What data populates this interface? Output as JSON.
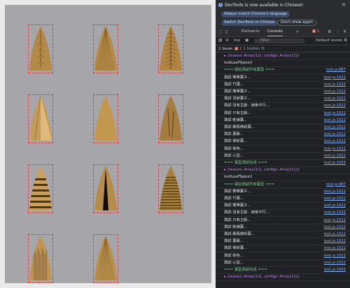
{
  "leaves": [
    {
      "id": "leaf-r1c1",
      "type": "veined",
      "color": "#b48a4a"
    },
    {
      "id": "leaf-r1c2",
      "type": "striped",
      "color": "#b58a48"
    },
    {
      "id": "leaf-r1c3",
      "type": "feathered",
      "color": "#b08444"
    },
    {
      "id": "leaf-r2c1",
      "type": "faceted",
      "color": "#c49c58"
    },
    {
      "id": "leaf-r2c2",
      "type": "plain",
      "color": "#c29850"
    },
    {
      "id": "leaf-r2c3",
      "type": "weathered",
      "color": "#a47c40"
    },
    {
      "id": "leaf-r3c1",
      "type": "banded",
      "color": "#c8a060"
    },
    {
      "id": "leaf-r3c2",
      "type": "dark-center",
      "color": "#b68c4c"
    },
    {
      "id": "leaf-r3c3",
      "type": "ribbed",
      "color": "#a8803e"
    },
    {
      "id": "leaf-r4c1",
      "type": "textured",
      "color": "#bf9454"
    },
    {
      "id": "leaf-r4c2",
      "type": "fine-striped",
      "color": "#b8904e"
    }
  ],
  "devtools": {
    "notice": {
      "message": "DevTools is now available in Chinese!",
      "match_button": "Always match Chrome's language",
      "switch_button": "Switch DevTools to Chinese",
      "dismiss_button": "Don't show again",
      "close_icon": "close-icon"
    },
    "tabs": {
      "elements": "Elements",
      "console": "Console",
      "error_count": "1"
    },
    "toolbar": {
      "context": "top",
      "filter_placeholder": "Filter",
      "levels": "Default levels"
    },
    "issues": {
      "label": "1 Issue:",
      "error_count": "1",
      "hidden": "1 hidden"
    },
    "console_rows": [
      {
        "text": "▸ {leaves: Array(11), configs: Array(11)}",
        "link": "",
        "cls": "hdr"
      },
      {
        "text": "testLeafTypes()",
        "link": "",
        "cls": "fn"
      },
      {
        "text": "=== 開始測試所有葉型 ===",
        "link": "test.js:987",
        "cls": "sys"
      },
      {
        "text": "測試 簡單葉子...",
        "link": "test.js:1022",
        "cls": ""
      },
      {
        "text": "測試 竹葉...",
        "link": "test.js:1022",
        "cls": ""
      },
      {
        "text": "測試 簡單葉子...",
        "link": "test.js:1022",
        "cls": ""
      },
      {
        "text": "測試 羽狀葉子...",
        "link": "test.js:1022",
        "cls": ""
      },
      {
        "text": "測試 沒有主脈 - 雨後平行...",
        "link": "test.js:1022",
        "cls": ""
      },
      {
        "text": "測試 只有主脈...",
        "link": "test.js:1022",
        "cls": ""
      },
      {
        "text": "測試 乾燥葉...",
        "link": "test.js:1022",
        "cls": ""
      },
      {
        "text": "測試 細長條紋葉...",
        "link": "test.js:1022",
        "cls": ""
      },
      {
        "text": "測試 葉脈...",
        "link": "test.js:1022",
        "cls": ""
      },
      {
        "text": "測試 條紋葉...",
        "link": "test.js:1022",
        "cls": ""
      },
      {
        "text": "測試 棕色...",
        "link": "test.js:1022",
        "cls": ""
      },
      {
        "text": "測試 心型...",
        "link": "test.js:1022",
        "cls": ""
      },
      {
        "text": "=== 葉型測試完成 ===",
        "link": "test.js:1055",
        "cls": "sys"
      },
      {
        "text": "▸ {leaves: Array(11), configs: Array(11)}",
        "link": "",
        "cls": "hdr"
      },
      {
        "text": "testLeafTypes()",
        "link": "",
        "cls": "fn"
      },
      {
        "text": "=== 開始測試所有葉型 ===",
        "link": "test.js:987",
        "cls": "sys"
      },
      {
        "text": "測試 簡單葉子...",
        "link": "test.js:1022",
        "cls": ""
      },
      {
        "text": "測試 竹葉...",
        "link": "test.js:1022",
        "cls": ""
      },
      {
        "text": "測試 簡單葉子...",
        "link": "test.js:1022",
        "cls": ""
      },
      {
        "text": "測試 沒有主脈 - 雨後平行...",
        "link": "test.js:1022",
        "cls": ""
      },
      {
        "text": "測試 只有主脈...",
        "link": "test.js:1022",
        "cls": ""
      },
      {
        "text": "測試 乾燥葉...",
        "link": "test.js:1022",
        "cls": ""
      },
      {
        "text": "測試 細長條紋葉...",
        "link": "test.js:1022",
        "cls": ""
      },
      {
        "text": "測試 葉脈...",
        "link": "test.js:1022",
        "cls": ""
      },
      {
        "text": "測試 條紋葉...",
        "link": "test.js:1022",
        "cls": ""
      },
      {
        "text": "測試 棕色...",
        "link": "test.js:1022",
        "cls": ""
      },
      {
        "text": "測試 心型...",
        "link": "test.js:1022",
        "cls": ""
      },
      {
        "text": "=== 葉型測試完成 ===",
        "link": "test.js:1055",
        "cls": "sys"
      },
      {
        "text": "▸ {leaves: Array(11), configs: Array(11)}",
        "link": "",
        "cls": "hdr"
      }
    ]
  }
}
